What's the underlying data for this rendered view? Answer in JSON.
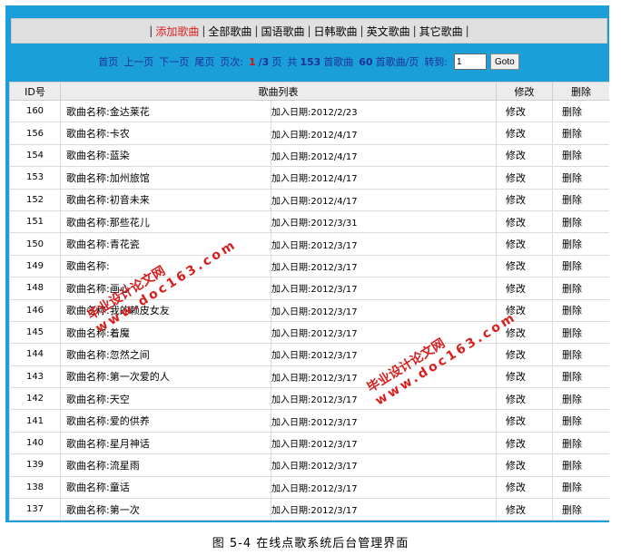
{
  "nav": {
    "items": [
      {
        "label": "添加歌曲",
        "active": true
      },
      {
        "label": "全部歌曲",
        "active": false
      },
      {
        "label": "国语歌曲",
        "active": false
      },
      {
        "label": "日韩歌曲",
        "active": false
      },
      {
        "label": "英文歌曲",
        "active": false
      },
      {
        "label": "其它歌曲",
        "active": false
      }
    ],
    "separator": "|"
  },
  "pager": {
    "first": "首页",
    "prev": "上一页",
    "next": "下一页",
    "last": "尾页",
    "page_label": "页次:",
    "current": "1",
    "total": "/3",
    "page_unit": "页",
    "total_prefix": "共",
    "total_count": "153",
    "total_suffix": "首歌曲",
    "per_page": "60",
    "per_page_suffix": "首歌曲/页",
    "goto_label": "转到:",
    "goto_value": "1",
    "goto_button": "Goto"
  },
  "table": {
    "headers": {
      "id": "ID号",
      "list": "歌曲列表",
      "edit": "修改",
      "delete": "删除"
    },
    "name_prefix": "歌曲名称:",
    "date_prefix": "加入日期:",
    "edit_label": "修改",
    "delete_label": "删除",
    "rows": [
      {
        "id": "160",
        "name": "金达莱花",
        "date": "2012/2/23"
      },
      {
        "id": "156",
        "name": "卡农",
        "date": "2012/4/17"
      },
      {
        "id": "154",
        "name": "蓝染",
        "date": "2012/4/17"
      },
      {
        "id": "153",
        "name": "加州旅馆",
        "date": "2012/4/17"
      },
      {
        "id": "152",
        "name": "初音未来",
        "date": "2012/4/17"
      },
      {
        "id": "151",
        "name": "那些花儿",
        "date": "2012/3/31"
      },
      {
        "id": "150",
        "name": "青花瓷",
        "date": "2012/3/17"
      },
      {
        "id": "149",
        "name": "",
        "date": "2012/3/17"
      },
      {
        "id": "148",
        "name": "画心",
        "date": "2012/3/17"
      },
      {
        "id": "146",
        "name": "我的赖皮女友",
        "date": "2012/3/17"
      },
      {
        "id": "145",
        "name": "着魔",
        "date": "2012/3/17"
      },
      {
        "id": "144",
        "name": "忽然之间",
        "date": "2012/3/17"
      },
      {
        "id": "143",
        "name": "第一次爱的人",
        "date": "2012/3/17"
      },
      {
        "id": "142",
        "name": "天空",
        "date": "2012/3/17"
      },
      {
        "id": "141",
        "name": "爱的供养",
        "date": "2012/3/17"
      },
      {
        "id": "140",
        "name": "星月神话",
        "date": "2012/3/17"
      },
      {
        "id": "139",
        "name": "流星雨",
        "date": "2012/3/17"
      },
      {
        "id": "138",
        "name": "童话",
        "date": "2012/3/17"
      },
      {
        "id": "137",
        "name": "第一次",
        "date": "2012/3/17"
      }
    ]
  },
  "watermark": {
    "cn": "毕业设计论文网",
    "url": "www.doc163.com"
  },
  "caption": "图 5-4 在线点歌系统后台管理界面"
}
